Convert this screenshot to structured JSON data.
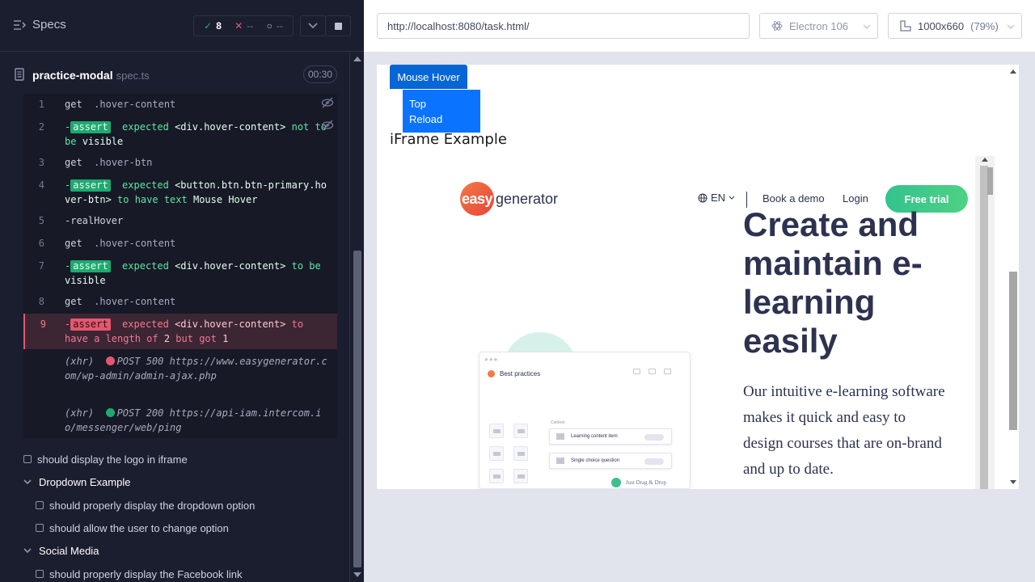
{
  "runner": {
    "specs_label": "Specs",
    "passed": "8",
    "failed": "--",
    "pending": "--",
    "spec_name": "practice-modal",
    "spec_ext": "spec.ts",
    "duration": "00:30"
  },
  "commands": [
    {
      "num": "1",
      "name": "get",
      "arg": ".hover-content"
    },
    {
      "num": "2",
      "badge": "assert",
      "pre": "expected",
      "code": "<div.hover-content>",
      "mid": "not to be",
      "val": "visible"
    },
    {
      "num": "3",
      "name": "get",
      "arg": ".hover-btn"
    },
    {
      "num": "4",
      "badge": "assert",
      "pre": "expected",
      "code": "<button.btn.btn-primary.hover-btn>",
      "mid": "to have text",
      "val": "Mouse Hover"
    },
    {
      "num": "5",
      "name": "-realHover"
    },
    {
      "num": "6",
      "name": "get",
      "arg": ".hover-content"
    },
    {
      "num": "7",
      "badge": "assert",
      "pre": "expected",
      "code": "<div.hover-content>",
      "mid": "to be",
      "val": "visible"
    },
    {
      "num": "8",
      "name": "get",
      "arg": ".hover-content"
    },
    {
      "num": "9",
      "badge": "assert",
      "pre": "expected",
      "code": "<div.hover-content>",
      "mid": "to have a length of",
      "val": "2",
      "mid2": "but got",
      "val2": "1"
    }
  ],
  "xhr": [
    {
      "label": "(xhr)",
      "status_text": "POST 500",
      "url": "https://www.easygenerator.com/wp-admin/admin-ajax.php",
      "color": "#e45770"
    },
    {
      "label": "(xhr)",
      "status_text": "POST 200",
      "url": "https://api-iam.intercom.io/messenger/web/ping",
      "color": "#1fa971"
    }
  ],
  "tests": {
    "logo_test": "should display the logo in iframe",
    "suite_dropdown": "Dropdown Example",
    "dropdown_test_1": "should properly display the dropdown option",
    "dropdown_test_2": "should allow the user to change option",
    "suite_social": "Social Media",
    "social_test_1": "should properly display the Facebook link"
  },
  "aut": {
    "url": "http://localhost:8080/task.html/",
    "browser": "Electron 106",
    "viewport": "1000x660",
    "zoom": "(79%)"
  },
  "page": {
    "hover_button": "Mouse Hover",
    "hover_items": [
      "Top",
      "Reload"
    ],
    "iframe_title": "iFrame Example"
  },
  "iframe": {
    "logo_mark": "easy",
    "logo_word": "generator",
    "lang": "EN",
    "book_demo": "Book a demo",
    "login": "Login",
    "free_trial": "Free trial",
    "hero_title": "Create and maintain e-learning easily",
    "hero_sub": "Our intuitive e-learning software makes it quick and easy to design courses that are on-brand and up to date.",
    "mock_title": "Best practices",
    "mock_label": "Content",
    "mock_card_1": "Learning content item",
    "mock_card_2": "Single choice question",
    "drag_note": "Just Drag & Drop"
  },
  "colors": {
    "pass": "#5fe5a6",
    "fail": "#e45770",
    "primary_button": "#0766d6",
    "trial": "#33c38e"
  }
}
